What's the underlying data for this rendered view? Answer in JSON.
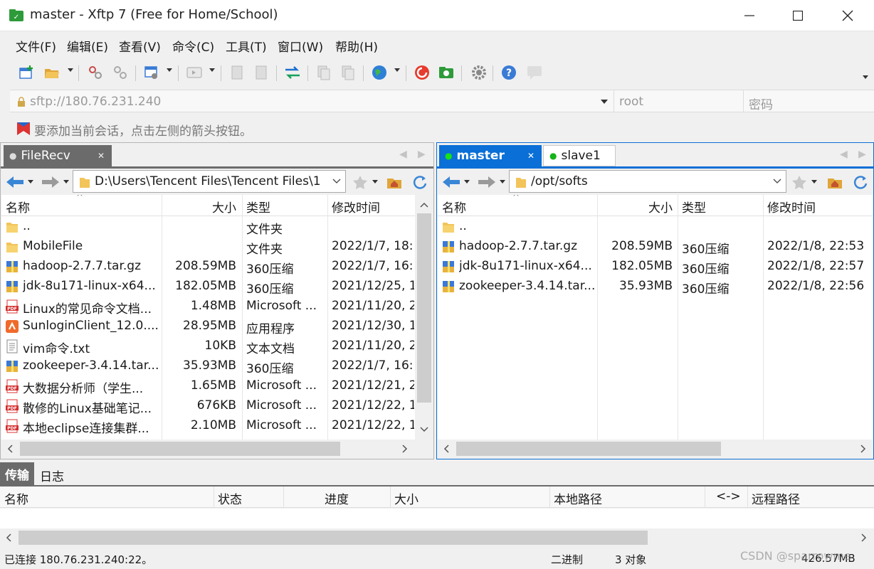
{
  "window": {
    "title": "master - Xftp 7 (Free for Home/School)"
  },
  "menu": [
    "文件(F)",
    "编辑(E)",
    "查看(V)",
    "命令(C)",
    "工具(T)",
    "窗口(W)",
    "帮助(H)"
  ],
  "address": {
    "host": "sftp://180.76.231.240",
    "user_placeholder": "root",
    "password_placeholder": "密码"
  },
  "hint": "要添加当前会话，点击左侧的箭头按钮。",
  "left_pane": {
    "tab": "FileRecv",
    "path": "D:\\Users\\Tencent Files\\Tencent Files\\1",
    "columns": [
      "名称",
      "大小",
      "类型",
      "修改时间"
    ],
    "rows": [
      {
        "icon": "folder-icon",
        "name": "..",
        "size": "",
        "type": "文件夹",
        "date": ""
      },
      {
        "icon": "folder-icon",
        "name": "MobileFile",
        "size": "",
        "type": "文件夹",
        "date": "2022/1/7, 18:"
      },
      {
        "icon": "archive-icon",
        "name": "hadoop-2.7.7.tar.gz",
        "size": "208.59MB",
        "type": "360压缩",
        "date": "2022/1/7, 16:"
      },
      {
        "icon": "archive-icon",
        "name": "jdk-8u171-linux-x64...",
        "size": "182.05MB",
        "type": "360压缩",
        "date": "2021/12/25, 1"
      },
      {
        "icon": "pdf-icon",
        "name": "Linux的常见命令文档...",
        "size": "1.48MB",
        "type": "Microsoft ...",
        "date": "2021/11/20, 2"
      },
      {
        "icon": "app-icon",
        "name": "SunloginClient_12.0....",
        "size": "28.95MB",
        "type": "应用程序",
        "date": "2021/12/30, 1"
      },
      {
        "icon": "text-file-icon",
        "name": "vim命令.txt",
        "size": "10KB",
        "type": "文本文档",
        "date": "2021/11/20, 2"
      },
      {
        "icon": "archive-icon",
        "name": "zookeeper-3.4.14.tar...",
        "size": "35.93MB",
        "type": "360压缩",
        "date": "2022/1/7, 16:"
      },
      {
        "icon": "pdf-icon",
        "name": "大数据分析师（学生...",
        "size": "1.65MB",
        "type": "Microsoft ...",
        "date": "2021/12/21, 2"
      },
      {
        "icon": "pdf-icon",
        "name": "散修的Linux基础笔记...",
        "size": "676KB",
        "type": "Microsoft ...",
        "date": "2021/12/22, 1"
      },
      {
        "icon": "pdf-icon",
        "name": "本地eclipse连接集群...",
        "size": "2.10MB",
        "type": "Microsoft ...",
        "date": "2021/12/22, 1"
      }
    ]
  },
  "right_pane": {
    "tabs": [
      "master",
      "slave1"
    ],
    "path": "/opt/softs",
    "columns": [
      "名称",
      "大小",
      "类型",
      "修改时间"
    ],
    "rows": [
      {
        "icon": "folder-icon",
        "name": "..",
        "size": "",
        "type": "",
        "date": ""
      },
      {
        "icon": "archive-icon",
        "name": "hadoop-2.7.7.tar.gz",
        "size": "208.59MB",
        "type": "360压缩",
        "date": "2022/1/8, 22:53"
      },
      {
        "icon": "archive-icon",
        "name": "jdk-8u171-linux-x64...",
        "size": "182.05MB",
        "type": "360压缩",
        "date": "2022/1/8, 22:57"
      },
      {
        "icon": "archive-icon",
        "name": "zookeeper-3.4.14.tar...",
        "size": "35.93MB",
        "type": "360压缩",
        "date": "2022/1/8, 22:56"
      }
    ]
  },
  "transfer": {
    "tabs": [
      "传输",
      "日志"
    ],
    "columns": [
      "名称",
      "状态",
      "进度",
      "大小",
      "本地路径",
      "<->",
      "远程路径"
    ]
  },
  "status": {
    "connection": "已连接 180.76.231.240:22。",
    "mode": "二进制",
    "count": "3 对象",
    "size": "426.57MB",
    "watermark": "CSDN @sparrowme"
  },
  "colors": {
    "accent": "#0078d7",
    "tab_active": "#0a6fd6",
    "connected_dot": "#17b317"
  }
}
